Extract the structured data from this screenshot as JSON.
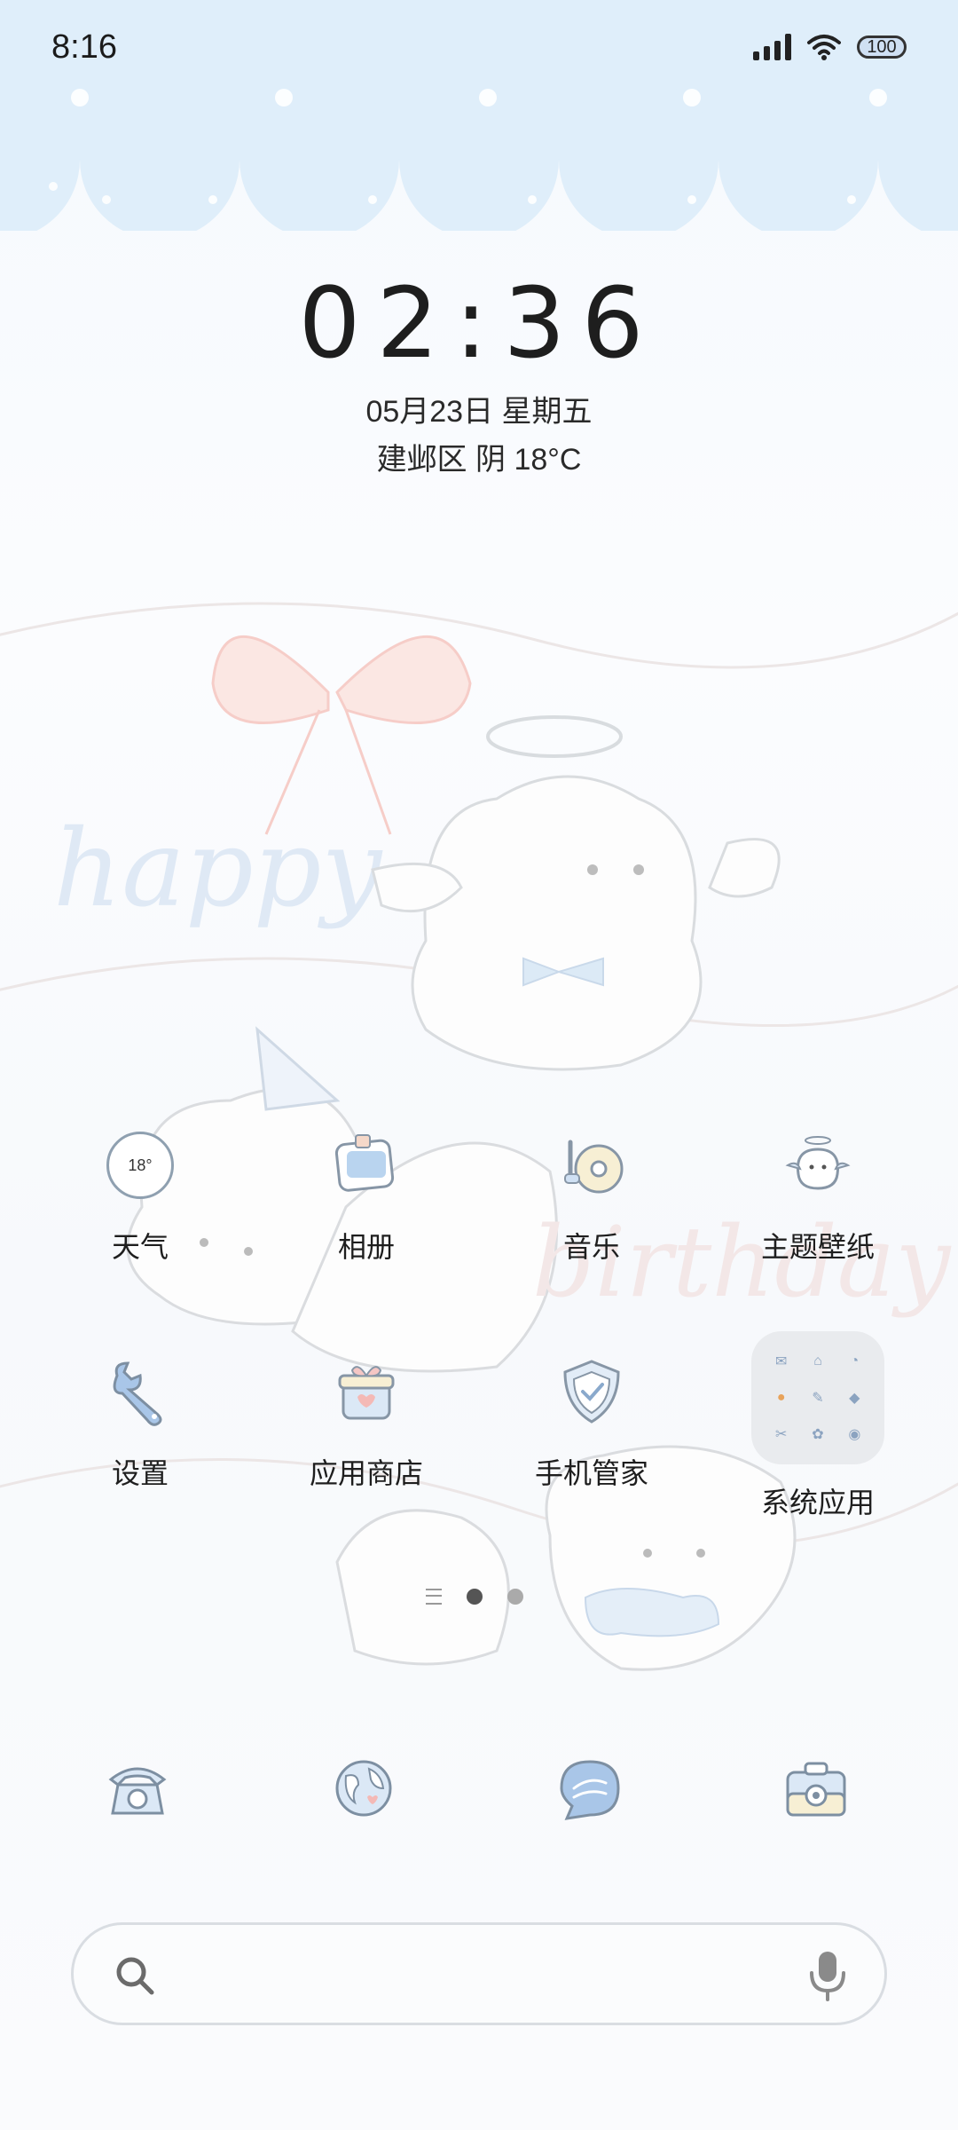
{
  "status_bar": {
    "time": "8:16",
    "battery": "100"
  },
  "clock_widget": {
    "time": "02:36",
    "date": "05月23日 星期五",
    "weather": "建邺区 阴 18°C"
  },
  "wallpaper": {
    "text_1": "happy",
    "text_2": "birthday"
  },
  "apps_row1": [
    {
      "label": "天气",
      "icon": "weather-icon",
      "icon_text": "18°"
    },
    {
      "label": "相册",
      "icon": "gallery-icon"
    },
    {
      "label": "音乐",
      "icon": "music-icon"
    },
    {
      "label": "主题壁纸",
      "icon": "themes-icon"
    }
  ],
  "apps_row2": [
    {
      "label": "设置",
      "icon": "settings-icon"
    },
    {
      "label": "应用商店",
      "icon": "app-store-icon"
    },
    {
      "label": "手机管家",
      "icon": "security-icon"
    },
    {
      "label": "系统应用",
      "icon": "folder-icon"
    }
  ],
  "dock": [
    "phone-icon",
    "browser-icon",
    "messages-icon",
    "camera-icon"
  ],
  "pager": {
    "pages": 2,
    "current": 1
  },
  "colors": {
    "accent_blue": "#a9c6e8",
    "line": "#9aa4ae",
    "pink": "#f4b9b6"
  }
}
